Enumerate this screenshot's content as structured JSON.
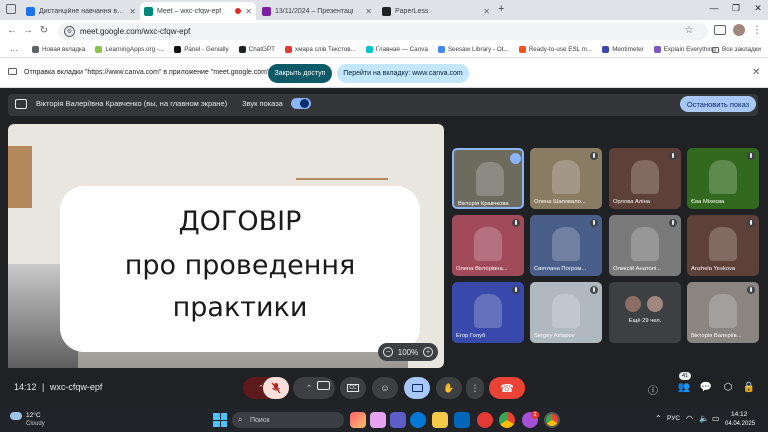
{
  "browser": {
    "tabs": [
      {
        "label": "Дистанційне навчання в ВСП",
        "color": "#1a73e8",
        "active": false
      },
      {
        "label": "Meet – wxc-cfqw-epf",
        "color": "#00897b",
        "active": true
      },
      {
        "label": "13/11/2024 – Презентаці",
        "color": "#7b1fa2",
        "active": false
      },
      {
        "label": "PaperLess",
        "color": "#202124",
        "active": false
      }
    ],
    "new_tab": "+",
    "url": "meet.google.com/wxc-cfqw-epf",
    "bookmarks": [
      {
        "label": "Новая вкладка",
        "color": "#5f6368"
      },
      {
        "label": "LearningApps.org -...",
        "color": "#8bc34a"
      },
      {
        "label": "Panel - Genially",
        "color": "#111"
      },
      {
        "label": "ChatGPT",
        "color": "#202124"
      },
      {
        "label": "хмара слів Текстов...",
        "color": "#e53935"
      },
      {
        "label": "Главная — Canva",
        "color": "#00c4cc"
      },
      {
        "label": "Seesaw Library - Ot...",
        "color": "#4285f4"
      },
      {
        "label": "Ready-to-use ESL m...",
        "color": "#f4511e"
      },
      {
        "label": "Mentimeter",
        "color": "#3949ab"
      },
      {
        "label": "Explain Everything",
        "color": "#7e57c2"
      }
    ],
    "all_bookmarks": "Все закладки"
  },
  "infobar": {
    "text": "Отправка вкладки \"https://www.canva.com\" в приложение \"meet.google.com\".",
    "access_label": "Закрыть доступ",
    "goto_label": "Перейти на вкладку: www.canva.com"
  },
  "presenting": {
    "text": "Вікторія Валеріївна Кравченко (вы, на главном экране)",
    "sound_label": "Звук показа",
    "stop_label": "Остановить показ"
  },
  "slide": {
    "line1": "ДОГОВІР",
    "line2": "про проведення",
    "line3": "практики",
    "zoom": "100%",
    "zoom_minus": "−",
    "zoom_plus": "+"
  },
  "participants": [
    {
      "name": "Вікторія Кравчкова",
      "bg": "#6d6a5e"
    },
    {
      "name": "Олена Шаповало...",
      "bg": "#8a7b63"
    },
    {
      "name": "Орлова Аліна",
      "bg": "#5d4037"
    },
    {
      "name": "Єва Міхеєва",
      "bg": "#33691e"
    },
    {
      "name": "Олена Вікторівна...",
      "bg": "#a14a5a"
    },
    {
      "name": "Светлана Погром...",
      "bg": "#4a5e8a"
    },
    {
      "name": "Олексій Анатолі...",
      "bg": "#7a7a7a"
    },
    {
      "name": "Anzhela Yeskova",
      "bg": "#5d4037"
    },
    {
      "name": "Егор Голуб",
      "bg": "#3949ab"
    },
    {
      "name": "Sergey Astapov",
      "bg": "#b0b8c0"
    },
    {
      "name": "Ещё 29 чел.",
      "bg": "#3c4043"
    },
    {
      "name": "Вікторія Валеріїв...",
      "bg": "#8a8580"
    }
  ],
  "meeting": {
    "time": "14:12",
    "code": "wxc-cfqw-epf",
    "people_count": "41"
  },
  "taskbar": {
    "temp": "12°C",
    "weather": "Cloudy",
    "search_placeholder": "Поиск",
    "lang": "РУС",
    "time": "14:12",
    "date": "04.04.2025",
    "chrome_badge": "2"
  }
}
